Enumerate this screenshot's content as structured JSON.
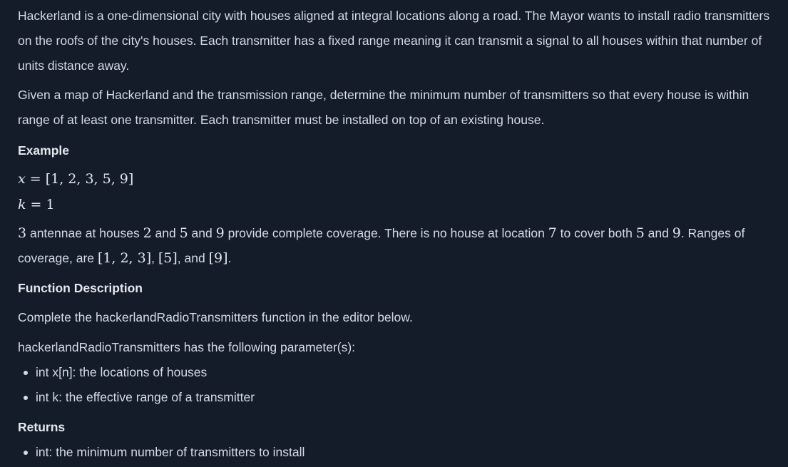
{
  "intro": {
    "p1": "Hackerland is a one-dimensional city with houses aligned at integral locations along a road. The Mayor wants to install radio transmitters on the roofs of the city's houses. Each transmitter has a fixed range meaning it can transmit a signal to all houses within that number of units distance away.",
    "p2": "Given a map of Hackerland and the transmission range, determine the minimum number of transmitters so that every house is within range of at least one transmitter. Each transmitter must be installed on top of an existing house."
  },
  "example": {
    "heading": "Example",
    "x_var": "x",
    "eq": " = ",
    "x_value": "[1, 2, 3, 5, 9]",
    "k_var": "k",
    "k_value": "1",
    "n3": "3",
    "t1": " antennae at houses ",
    "h2": "2",
    "t2": " and ",
    "h5": "5",
    "t3": " and ",
    "h9": "9",
    "t4": " provide complete coverage. There is no house at location ",
    "h7": "7",
    "t5": " to cover both ",
    "h5b": "5",
    "t6": " and ",
    "h9b": "9",
    "t7": ". Ranges of coverage, are ",
    "r1": "[1, 2, 3]",
    "sep1": ", ",
    "r2": "[5]",
    "t8": ", and ",
    "r3": "[9]",
    "t9": "."
  },
  "function_description": {
    "heading": "Function Description",
    "line1": "Complete the hackerlandRadioTransmitters function in the editor below.",
    "line2": "hackerlandRadioTransmitters has the following parameter(s):",
    "params": [
      "int x[n]: the locations of houses",
      "int k: the effective range of a transmitter"
    ]
  },
  "returns": {
    "heading": "Returns",
    "items": [
      "int: the minimum number of transmitters to install"
    ]
  },
  "colors": {
    "background": "#141b29",
    "text": "#d5dbe3"
  }
}
